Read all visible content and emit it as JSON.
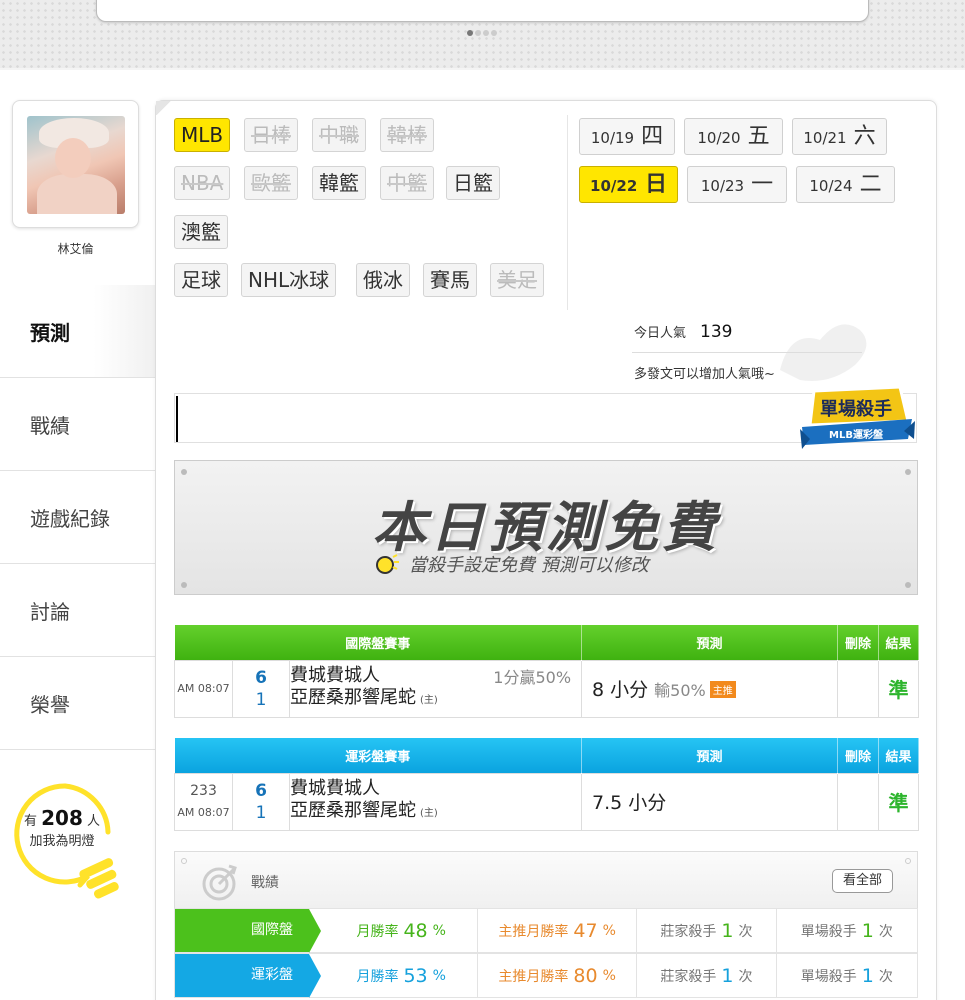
{
  "profile": {
    "name": "林艾倫"
  },
  "nav": [
    {
      "label": "預測",
      "active": true
    },
    {
      "label": "戰績"
    },
    {
      "label": "遊戲紀錄"
    },
    {
      "label": "討論"
    },
    {
      "label": "榮譽"
    }
  ],
  "fans": {
    "prefix": "有",
    "count": "208",
    "suffix": "人",
    "line2": "加我為明燈"
  },
  "sports": {
    "mlb": "MLB",
    "npb": "日棒",
    "cpbl": "中職",
    "kbo": "韓棒",
    "nba": "NBA",
    "euro": "歐籃",
    "kbl": "韓籃",
    "cba": "中籃",
    "jbl": "日籃",
    "nbl": "澳籃",
    "soccer": "足球",
    "nhl": "NHL冰球",
    "khl": "俄冰",
    "horse": "賽馬",
    "nfl": "美足"
  },
  "dates": [
    {
      "md": "10/19",
      "wd": "四"
    },
    {
      "md": "10/20",
      "wd": "五"
    },
    {
      "md": "10/21",
      "wd": "六"
    },
    {
      "md": "10/22",
      "wd": "日",
      "active": true
    },
    {
      "md": "10/23",
      "wd": "一"
    },
    {
      "md": "10/24",
      "wd": "二"
    }
  ],
  "popularity": {
    "label": "今日人氣",
    "value": "139",
    "hint": "多發文可以增加人氣哦~"
  },
  "badge": {
    "title": "單場殺手",
    "ribbon": "MLB運彩盤"
  },
  "free": {
    "title": "本日預測免費",
    "subtitle": "當殺手設定免費  預測可以修改"
  },
  "intl_table": {
    "headers": {
      "event": "國際盤賽事",
      "pred": "預測",
      "del": "刪除",
      "res": "結果"
    },
    "row": {
      "time": "AM 08:07",
      "score_a": "6",
      "score_b": "1",
      "team_a": "費城費城人",
      "team_b": "亞歷桑那響尾蛇",
      "home": "(主)",
      "handicap": "1分贏50%",
      "pred": "8 小分",
      "lose": "輸50%",
      "tag": "主推",
      "result": "準"
    }
  },
  "sport_table": {
    "headers": {
      "event": "運彩盤賽事",
      "pred": "預測",
      "del": "刪除",
      "res": "結果"
    },
    "row": {
      "code": "233",
      "time": "AM 08:07",
      "score_a": "6",
      "score_b": "1",
      "team_a": "費城費城人",
      "team_b": "亞歷桑那響尾蛇",
      "home": "(主)",
      "pred": "7.5 小分",
      "result": "準"
    }
  },
  "record": {
    "title": "戰績",
    "view_all": "看全部",
    "rows": [
      {
        "label": "國際盤",
        "m_label": "月勝率",
        "m_val": "48",
        "z_label": "主推月勝率",
        "z_val": "47",
        "pct": "%",
        "zj_label": "莊家殺手",
        "zj_val": "1",
        "dc_label": "單場殺手",
        "dc_val": "1",
        "unit": "次"
      },
      {
        "label": "運彩盤",
        "m_label": "月勝率",
        "m_val": "53",
        "z_label": "主推月勝率",
        "z_val": "80",
        "pct": "%",
        "zj_label": "莊家殺手",
        "zj_val": "1",
        "dc_label": "單場殺手",
        "dc_val": "1",
        "unit": "次"
      }
    ]
  },
  "colors": {
    "accent": "#ffe600",
    "green": "#4cc11c",
    "blue": "#14a8e4",
    "orange": "#e88a2e"
  }
}
